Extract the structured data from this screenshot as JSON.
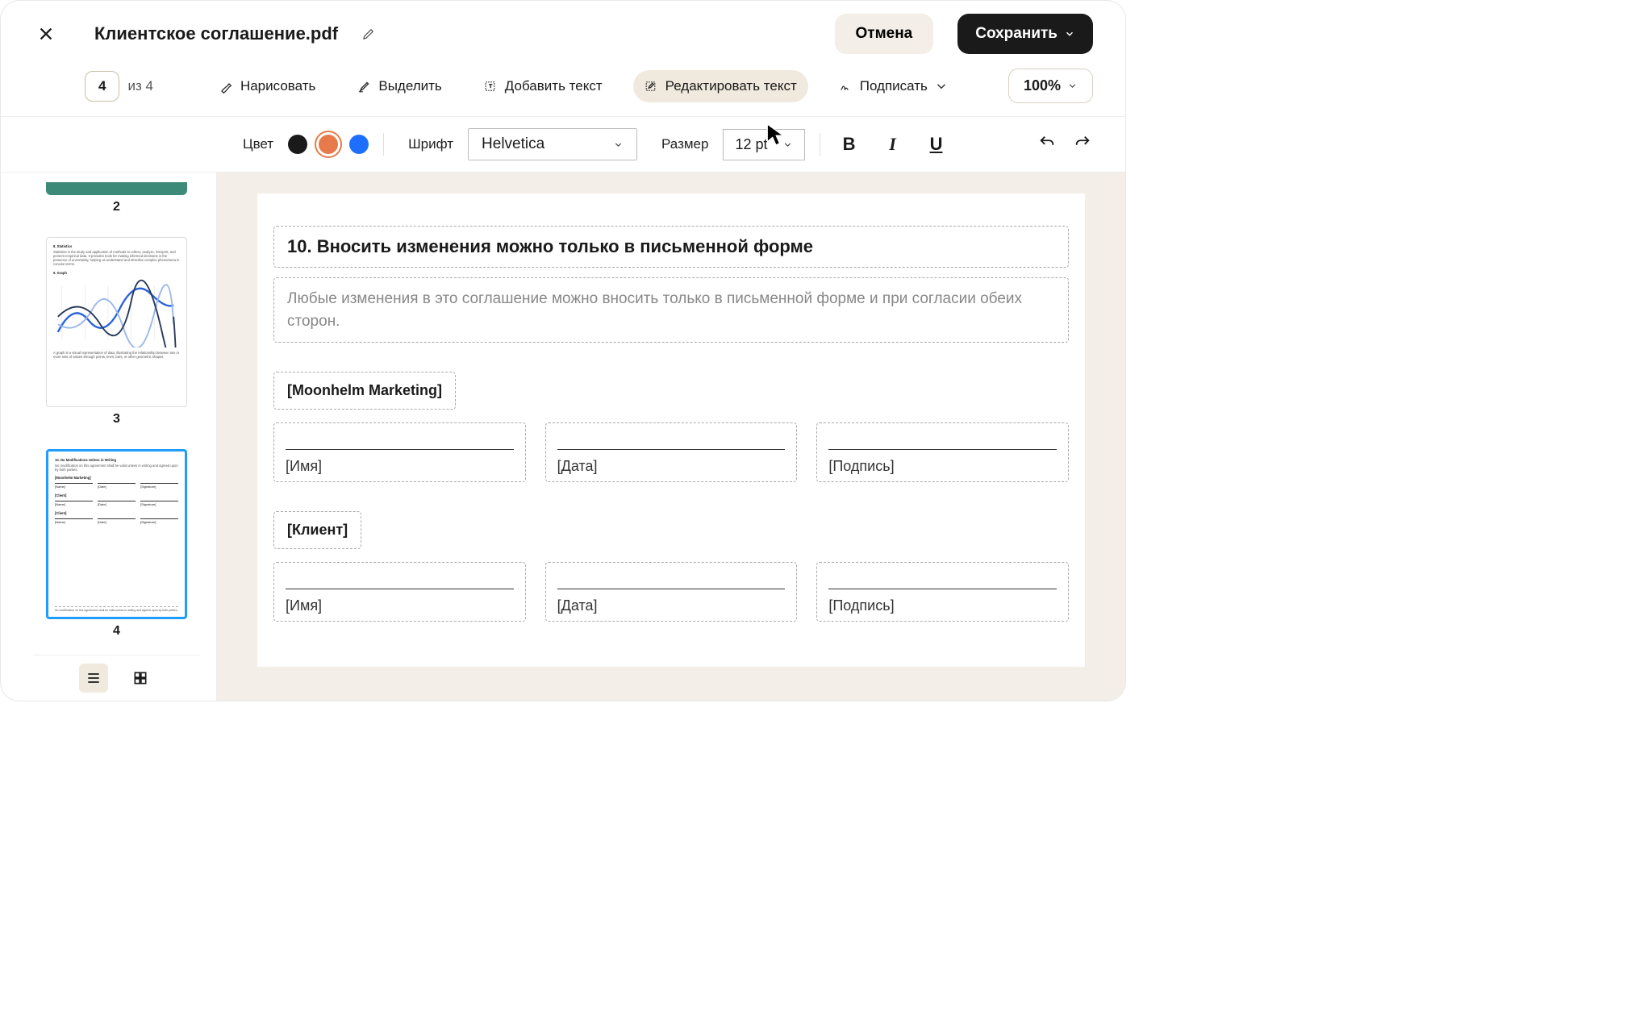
{
  "header": {
    "title": "Клиентское соглашение.pdf",
    "cancel": "Отмена",
    "save": "Сохранить"
  },
  "toolbar": {
    "page_current": "4",
    "page_total_prefix": "из ",
    "page_total": "4",
    "draw": "Нарисовать",
    "highlight": "Выделить",
    "add_text": "Добавить текст",
    "edit_text": "Редактировать текст",
    "sign": "Подписать",
    "zoom": "100%"
  },
  "format": {
    "color_label": "Цвет",
    "font_label": "Шрифт",
    "font_value": "Helvetica",
    "size_label": "Размер",
    "size_value": "12 pt",
    "colors": {
      "black": "#1a1a1a",
      "orange": "#e67a4a",
      "blue": "#1f6fff"
    }
  },
  "thumbs": {
    "n2": "2",
    "n3": "3",
    "n4": "4",
    "p3": {
      "h1": "8. Statistics",
      "body1": "Statistics is the study and application of methods to collect, analyze, interpret, and present empirical data. It provides tools for making informed decisions in the presence of uncertainty, helping us understand and describe complex phenomena in concise terms.",
      "h2": "9. Graph",
      "body2": "A graph is a visual representation of data, illustrating the relationship between two or more sets of values through points, lines, bars, or other geometric shapes."
    },
    "p4": {
      "h1": "10. No Modifications Unless in Writing",
      "body1": "No modification on this agreement shall be valid unless in writing and agreed upon by both parties.",
      "company": "[Moonhelm Marketing]",
      "name": "[Name]",
      "date": "[Date]",
      "sig": "[Signature]",
      "client": "[Client]",
      "footer": "No modification on this agreement shall be valid unless in writing and agreed upon by both parties."
    }
  },
  "doc": {
    "section_title": "10. Вносить изменения можно только в письменной форме",
    "section_body": "Любые изменения в это соглашение можно вносить только в письменной форме и при согласии обеих сторон.",
    "company": "[Moonhelm Marketing]",
    "row1": {
      "name": "[Имя]",
      "date": "[Дата]",
      "sig": "[Подпись]"
    },
    "client": "[Клиент]",
    "row2": {
      "name": "[Имя]",
      "date": "[Дата]",
      "sig": "[Подпись]"
    }
  }
}
